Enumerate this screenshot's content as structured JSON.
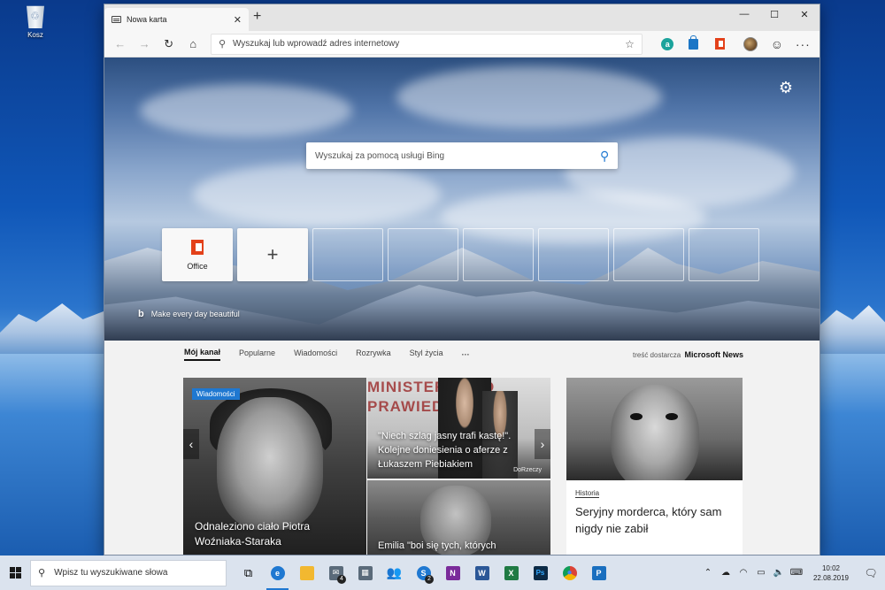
{
  "desktop": {
    "recycle_bin_label": "Kosz"
  },
  "browser": {
    "tab_title": "Nowa karta",
    "address_placeholder": "Wyszukaj lub wprowadź adres internetowy",
    "extensions": [
      "amazon-icon",
      "shopping-bag-icon",
      "office-icon",
      "profile-avatar",
      "feedback-smiley-icon",
      "settings-more-icon"
    ]
  },
  "newtab": {
    "search_placeholder": "Wyszukaj za pomocą usługi Bing",
    "tiles": [
      {
        "label": "Office",
        "icon": "office-icon"
      },
      {
        "label": "",
        "icon": "plus-icon"
      }
    ],
    "empty_tile_count": 6,
    "tagline": "Make every day beautiful"
  },
  "feed": {
    "tabs": [
      "Mój kanał",
      "Popularne",
      "Wiadomości",
      "Rozrywka",
      "Styl życia"
    ],
    "more": "···",
    "provider_prefix": "treść dostarcza",
    "provider_name": "Microsoft News",
    "cards": {
      "main": {
        "badge": "Wiadomości",
        "headline": "Odnaleziono ciało Piotra Woźniaka-Staraka"
      },
      "top_right": {
        "bg_text_1": "MINISTERSTWO",
        "bg_text_2": "PRAWIEDLIWOŚ",
        "headline": "\"Niech szlag jasny trafi kastę!\". Kolejne doniesienia o aferze z Łukaszem Piebiakiem",
        "source": "DoRzeczy"
      },
      "bottom_right": {
        "headline": "Emilia \"boi się tych, których"
      },
      "side": {
        "category": "Historia",
        "headline": "Seryjny morderca, który sam nigdy nie zabił"
      }
    }
  },
  "taskbar": {
    "search_placeholder": "Wpisz tu wyszukiwane słowa",
    "apps": [
      {
        "name": "task-view-icon",
        "color": "#dbe3ee",
        "glyph": "⧉"
      },
      {
        "name": "edge-icon",
        "color": "#1f78d1",
        "glyph": "e"
      },
      {
        "name": "file-explorer-icon",
        "color": "#f2b830",
        "glyph": ""
      },
      {
        "name": "mail-icon",
        "color": "#5a6a7a",
        "glyph": "✉"
      },
      {
        "name": "calendar-icon",
        "color": "#5a6a7a",
        "glyph": "▦"
      },
      {
        "name": "people-icon",
        "color": "#2a3a5a",
        "glyph": "👥"
      },
      {
        "name": "skype-icon",
        "color": "#1f78d1",
        "glyph": "S"
      },
      {
        "name": "onenote-icon",
        "color": "#7a2b9a",
        "glyph": "N"
      },
      {
        "name": "word-icon",
        "color": "#2b5797",
        "glyph": "W"
      },
      {
        "name": "excel-icon",
        "color": "#1f7a43",
        "glyph": "X"
      },
      {
        "name": "photoshop-icon",
        "color": "#0b2a46",
        "glyph": "Ps"
      },
      {
        "name": "chrome-icon",
        "color": "#2a7ad8",
        "glyph": "◉"
      },
      {
        "name": "planner-icon",
        "color": "#1a6fbf",
        "glyph": "P"
      }
    ],
    "mail_badge": "4",
    "skype_badge": "2",
    "time": "10:02",
    "date": "22.08.2019"
  }
}
